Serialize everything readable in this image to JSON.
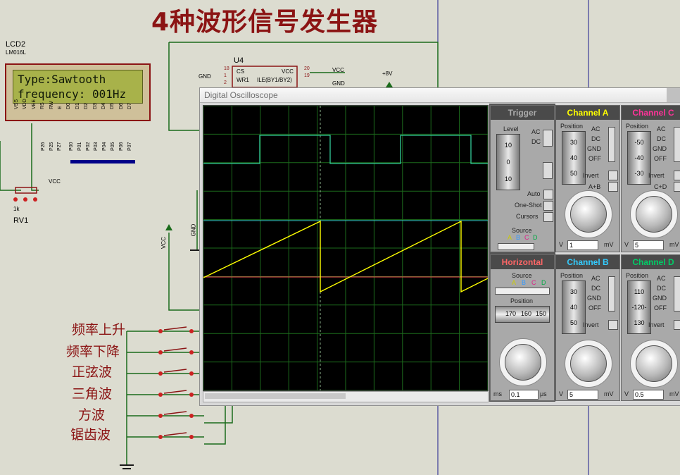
{
  "schematic": {
    "title": "4种波形信号发生器",
    "lcd_ref": "LCD2",
    "lcd_model": "LM016L",
    "lcd_line1": "Type:Sawtooth",
    "lcd_line2": "frequency: 001Hz",
    "lcd_pins": [
      "VSS",
      "VDD",
      "VEE",
      "RS",
      "RW",
      "E",
      "D0",
      "D1",
      "D2",
      "D3",
      "D4",
      "D5",
      "D6",
      "D7"
    ],
    "lcd_pin_nets": [
      "P26",
      "P25",
      "P27",
      "P00",
      "P01",
      "P02",
      "P03",
      "P04",
      "P05",
      "P06",
      "P07"
    ],
    "u4_ref": "U4",
    "u4_pin_cs": "CS",
    "u4_pin_wr1": "WR1",
    "u4_pin_ile": "ILE(BY1/BY2)",
    "u4_pin_vcc": "VCC",
    "pin_18": "18",
    "pin_1": "1",
    "pin_2": "2",
    "pin_3": "3",
    "pin_20": "20",
    "pin_19": "19",
    "pin_18b": "18",
    "gnd": "GND",
    "vcc": "VCC",
    "plus8v": "+8V",
    "rv_ref": "RV1",
    "rv_val": "1k",
    "buttons": [
      "频率上升",
      "频率下降",
      "正弦波",
      "三角波",
      "方波",
      "锯齿波"
    ]
  },
  "oscilloscope": {
    "title": "Digital Oscilloscope",
    "trigger": {
      "header": "Trigger",
      "level": "Level",
      "level_ticks": [
        "10",
        "0",
        "10"
      ],
      "ac": "AC",
      "dc": "DC",
      "auto": "Auto",
      "one_shot": "One-Shot",
      "cursors": "Cursors",
      "source": "Source",
      "source_letters": [
        "A",
        "B",
        "C",
        "D"
      ]
    },
    "horizontal": {
      "header": "Horizontal",
      "source": "Source",
      "source_letters": [
        "A",
        "B",
        "C",
        "D"
      ],
      "position": "Position",
      "scale": [
        "170",
        "160",
        "150"
      ],
      "dial_labels": [
        "0.5",
        "0.2",
        "0.1",
        "50",
        "20",
        "10",
        "5",
        "2",
        "1",
        "0.5",
        "200",
        "100"
      ],
      "unit_ms": "ms",
      "value": "0.1",
      "unit_us": "μs"
    },
    "channel_a": {
      "header": "Channel A",
      "position": "Position",
      "drum": [
        "30",
        "40",
        "50"
      ],
      "ac": "AC",
      "dc": "DC",
      "gnd": "GND",
      "off": "OFF",
      "invert": "Invert",
      "extra": "A+B",
      "v": "V",
      "value": "1",
      "mv": "mV"
    },
    "channel_b": {
      "header": "Channel B",
      "position": "Position",
      "drum": [
        "30",
        "40",
        "50"
      ],
      "ac": "AC",
      "dc": "DC",
      "gnd": "GND",
      "off": "OFF",
      "invert": "Invert",
      "v": "V",
      "value": "5",
      "mv": "mV"
    },
    "channel_c": {
      "header": "Channel C",
      "position": "Position",
      "drum": [
        "-50",
        "-40",
        "-30"
      ],
      "ac": "AC",
      "dc": "DC",
      "gnd": "GND",
      "off": "OFF",
      "invert": "Invert",
      "extra": "C+D",
      "v": "V",
      "value": "5",
      "mv": "mV"
    },
    "channel_d": {
      "header": "Channel D",
      "position": "Position",
      "drum": [
        "110",
        "-120-",
        "130"
      ],
      "ac": "AC",
      "dc": "DC",
      "gnd": "GND",
      "off": "OFF",
      "invert": "Invert",
      "v": "V",
      "value": "0.5",
      "mv": "mV"
    },
    "volt_dial_labels": [
      "0.5",
      "0.2",
      "0.1",
      "50",
      "20",
      "10",
      "5",
      "2",
      "1",
      "20",
      "10",
      "5",
      "2"
    ],
    "colors": {
      "channel_a": "#ffff00",
      "channel_b": "#33ccff",
      "channel_c": "#ff3399",
      "channel_d": "#00cc66",
      "trace_square": "#33cc99",
      "trace_mid": "#33cccc",
      "trace_red": "#ff5555",
      "grid": "#1c6b1c",
      "header_text": "#ff6666"
    }
  }
}
